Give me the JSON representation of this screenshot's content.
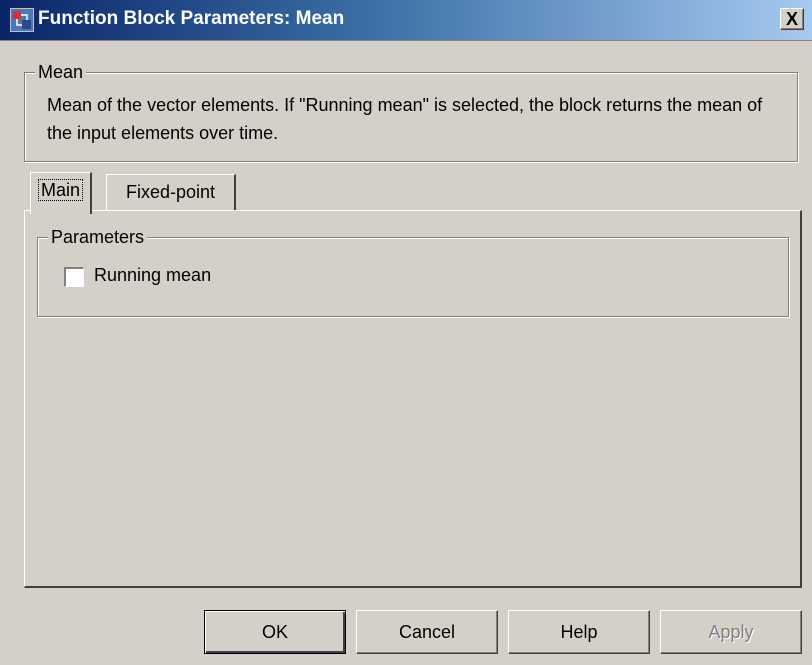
{
  "window": {
    "title": "Function Block Parameters: Mean",
    "close_label": "X"
  },
  "description_group": {
    "legend": "Mean",
    "text": "Mean of the vector elements. If \"Running mean\" is selected, the block returns the mean of the input elements over time."
  },
  "tabs": [
    {
      "label": "Main",
      "active": true
    },
    {
      "label": "Fixed-point",
      "active": false
    }
  ],
  "parameters_group": {
    "legend": "Parameters",
    "running_mean": {
      "label": "Running mean",
      "checked": false
    }
  },
  "buttons": {
    "ok": "OK",
    "cancel": "Cancel",
    "help": "Help",
    "apply": "Apply"
  }
}
